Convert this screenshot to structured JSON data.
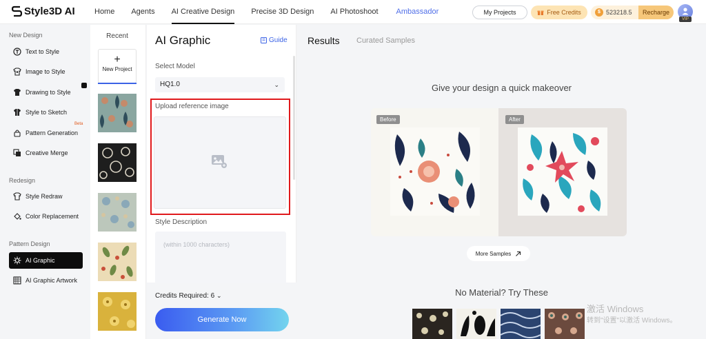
{
  "brand": {
    "name": "Style3D AI"
  },
  "nav": {
    "links": [
      "Home",
      "Agents",
      "AI Creative Design",
      "Precise 3D Design",
      "AI Photoshoot",
      "Ambassador"
    ],
    "active": "AI Creative Design",
    "my_projects": "My Projects",
    "free_credits": "Free Credits",
    "credits_balance": "523218.5",
    "recharge": "Recharge",
    "vip_badge": "VIP"
  },
  "sidebar": {
    "sections": [
      "New Design",
      "Redesign",
      "Pattern Design"
    ],
    "new_design": [
      {
        "label": "Text to Style",
        "icon": "t-shirt-text-icon"
      },
      {
        "label": "Image to Style",
        "icon": "image-shirt-icon"
      },
      {
        "label": "Drawing to Style",
        "icon": "drawing-shirt-icon"
      },
      {
        "label": "Style to Sketch",
        "icon": "sketch-shirt-icon"
      },
      {
        "label": "Pattern Generation",
        "icon": "pattern-lock-icon"
      },
      {
        "label": "Creative Merge",
        "icon": "merge-icon"
      }
    ],
    "beta_label": "Beta",
    "redesign": [
      {
        "label": "Style Redraw",
        "icon": "redraw-shirt-icon"
      },
      {
        "label": "Color Replacement",
        "icon": "color-bucket-icon"
      }
    ],
    "pattern_design": [
      {
        "label": "AI Graphic",
        "icon": "ai-graphic-icon",
        "active": true
      },
      {
        "label": "AI Graphic Artwork",
        "icon": "artwork-icon"
      }
    ]
  },
  "recent": {
    "title": "Recent",
    "new_project": "New Project"
  },
  "form": {
    "title": "AI Graphic",
    "guide": "Guide",
    "model_label": "Select Model",
    "model_value": "HQ1.0",
    "upload_label": "Upload reference image",
    "style_label": "Style Description",
    "style_placeholder": "(within 1000 characters)",
    "credits_required": "Credits Required: 6",
    "generate": "Generate Now"
  },
  "results": {
    "tab_results": "Results",
    "tab_curated": "Curated Samples",
    "headline": "Give your design a quick makeover",
    "before": "Before",
    "after": "After",
    "more_samples": "More Samples",
    "no_material": "No Material? Try These"
  },
  "os_watermark": {
    "line1": "激活 Windows",
    "line2": "转到\"设置\"以激活 Windows。"
  }
}
